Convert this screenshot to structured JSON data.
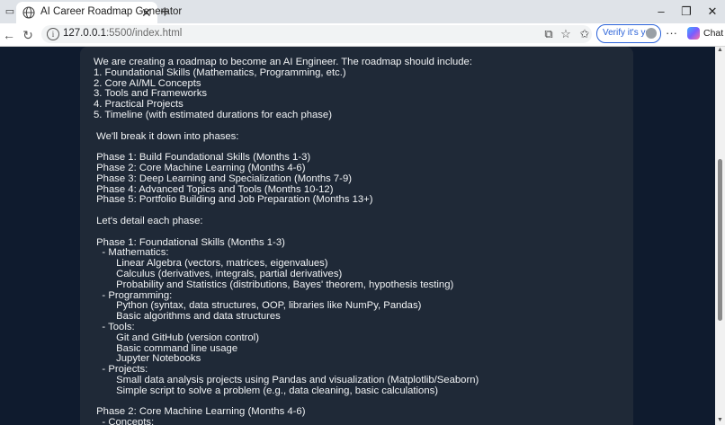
{
  "browser": {
    "tab_title": "AI Career Roadmap Generator",
    "url_host": "127.0.0.1",
    "url_rest": ":5500/index.html",
    "verify_label": "Verify it's you",
    "chat_label": "Chat",
    "tab_close": "✕",
    "new_tab": "+",
    "minimize": "–",
    "maximize": "❐",
    "close": "✕",
    "more": "···",
    "back": "←",
    "reload": "↻"
  },
  "roadmap": {
    "lines": [
      "We are creating a roadmap to become an AI Engineer. The roadmap should include:",
      "1. Foundational Skills (Mathematics, Programming, etc.)",
      "2. Core AI/ML Concepts",
      "3. Tools and Frameworks",
      "4. Practical Projects",
      "5. Timeline (with estimated durations for each phase)",
      "",
      " We'll break it down into phases:",
      "",
      " Phase 1: Build Foundational Skills (Months 1-3)",
      " Phase 2: Core Machine Learning (Months 4-6)",
      " Phase 3: Deep Learning and Specialization (Months 7-9)",
      " Phase 4: Advanced Topics and Tools (Months 10-12)",
      " Phase 5: Portfolio Building and Job Preparation (Months 13+)",
      "",
      " Let's detail each phase:",
      "",
      " Phase 1: Foundational Skills (Months 1-3)",
      "   - Mathematics:",
      "        Linear Algebra (vectors, matrices, eigenvalues)",
      "        Calculus (derivatives, integrals, partial derivatives)",
      "        Probability and Statistics (distributions, Bayes' theorem, hypothesis testing)",
      "   - Programming:",
      "        Python (syntax, data structures, OOP, libraries like NumPy, Pandas)",
      "        Basic algorithms and data structures",
      "   - Tools:",
      "        Git and GitHub (version control)",
      "        Basic command line usage",
      "        Jupyter Notebooks",
      "   - Projects:",
      "        Small data analysis projects using Pandas and visualization (Matplotlib/Seaborn)",
      "        Simple script to solve a problem (e.g., data cleaning, basic calculations)",
      "",
      " Phase 2: Core Machine Learning (Months 4-6)",
      "   - Concepts:"
    ]
  }
}
